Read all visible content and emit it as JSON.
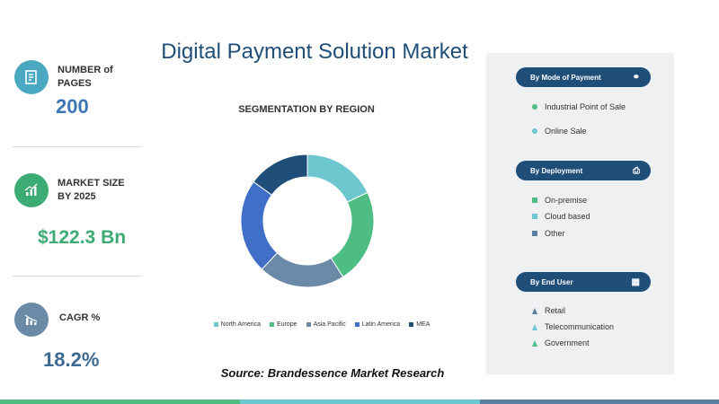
{
  "title": "Digital Payment Solution Market",
  "stats": {
    "pages": {
      "label_line1": "NUMBER of",
      "label_line2": "PAGES",
      "value": "200"
    },
    "market_size": {
      "label_line1": "MARKET SIZE",
      "label_line2": "BY 2025",
      "value": "$122.3 Bn"
    },
    "cagr": {
      "label": "CAGR %",
      "value": "18.2%"
    }
  },
  "colors": {
    "navy": "#1f4e79",
    "teal": "#5bbcc6",
    "green": "#4dbd84",
    "steel": "#5a7fa3",
    "value_blue": "#3d77b6",
    "value_green": "#3dac74",
    "value_slate": "#3d6a93"
  },
  "chart_data": {
    "type": "pie",
    "title": "SEGMENTATION  BY REGION",
    "categories": [
      "North America",
      "Europe",
      "Asia Pacific",
      "Latin America",
      "MEA"
    ],
    "values": [
      18,
      23,
      21,
      23,
      15
    ],
    "colors": [
      "#6ec6cf",
      "#4dbd84",
      "#6b8aa8",
      "#3f6fc7",
      "#1f4e79"
    ],
    "legend_position": "bottom"
  },
  "source": "Source: Brandessence Market Research",
  "panel": {
    "sections": [
      {
        "title": "By Mode of Payment",
        "icon": "handshake-icon",
        "items": [
          {
            "label": "Industrial Point of Sale",
            "color": "#4dbd84"
          },
          {
            "label": "Online Sale",
            "color": "#6ec6cf"
          }
        ]
      },
      {
        "title": "By  Deployment",
        "icon": "printer-icon",
        "items": [
          {
            "label": "On-premise",
            "color": "#4dbd84"
          },
          {
            "label": "Cloud based",
            "color": "#6ec6cf"
          },
          {
            "label": "Other",
            "color": "#5a7fa3"
          }
        ]
      },
      {
        "title": "By End User",
        "icon": "building-icon",
        "items": [
          {
            "label": "Retail",
            "color": "#5a7fa3"
          },
          {
            "label": "Telecommunication",
            "color": "#6ec6cf"
          },
          {
            "label": "Government",
            "color": "#4dbd84"
          }
        ]
      }
    ]
  }
}
